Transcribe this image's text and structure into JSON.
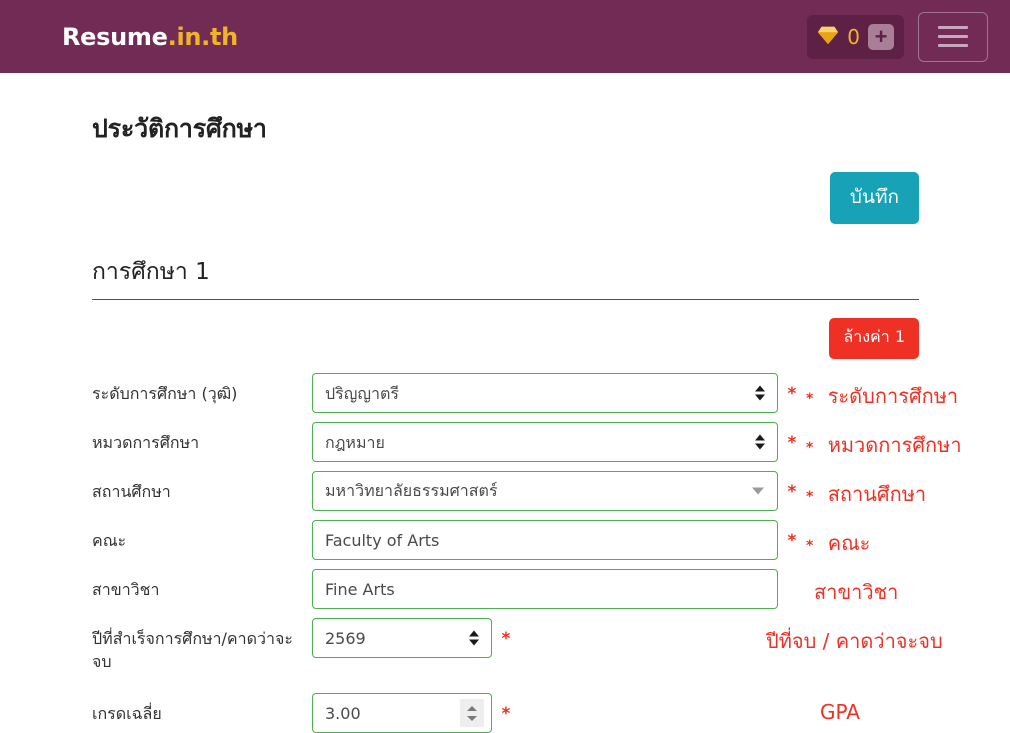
{
  "header": {
    "brand_name": "Resume",
    "brand_tld": ".in.th",
    "coin_count": "0",
    "plus_label": "+",
    "gem_icon": "gem-icon",
    "menu_icon": "hamburger-icon"
  },
  "page": {
    "title": "ประวัติการศึกษา",
    "save_label": "บันทึก",
    "section_title": "การศึกษา 1",
    "clear_label": "ล้างค่า 1"
  },
  "form": {
    "fields": [
      {
        "label": "ระดับการศึกษา (วุฒิ)",
        "value": "ปริญญาตรี",
        "required": "*",
        "annotation": "ระดับการศึกษา",
        "annotation_star": "*"
      },
      {
        "label": "หมวดการศึกษา",
        "value": "กฎหมาย",
        "required": "*",
        "annotation": "หมวดการศึกษา",
        "annotation_star": "*"
      },
      {
        "label": "สถานศึกษา",
        "value": "มหาวิทยาลัยธรรมศาสตร์",
        "required": "*",
        "annotation": "สถานศึกษา",
        "annotation_star": "*"
      },
      {
        "label": "คณะ",
        "value": "Faculty of Arts",
        "required": "*",
        "annotation": "คณะ",
        "annotation_star": "*"
      },
      {
        "label": "สาขาวิชา",
        "value": "Fine Arts",
        "required": "",
        "annotation": "สาขาวิชา",
        "annotation_star": ""
      },
      {
        "label": "ปีที่สำเร็จการศึกษา/คาดว่าจะจบ",
        "value": "2569",
        "required": "*",
        "annotation": "ปีที่จบ / คาดว่าจะจบ",
        "annotation_star": ""
      },
      {
        "label": "เกรดเฉลี่ย",
        "value": "3.00",
        "required": "*",
        "annotation": "GPA",
        "annotation_star": ""
      }
    ]
  },
  "colors": {
    "header_bg": "#722b54",
    "brand_accent": "#f0b429",
    "save_bg": "#17a2b8",
    "clear_bg": "#ee3124",
    "input_border": "#4caf50",
    "annotation": "#ee3124"
  }
}
